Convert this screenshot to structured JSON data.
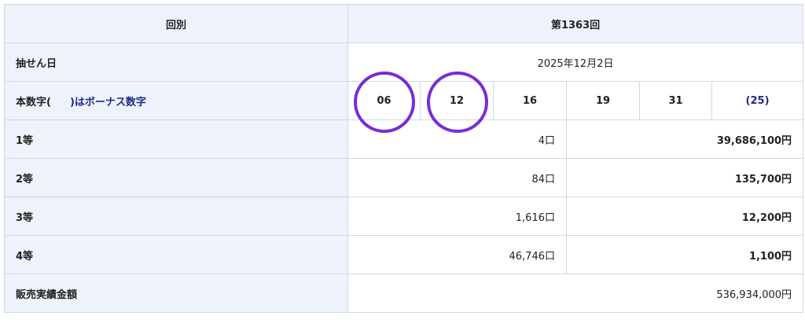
{
  "header": {
    "label": "回別",
    "value": "第1363回"
  },
  "draw_date": {
    "label": "抽せん日",
    "value": "2025年12月2日"
  },
  "numbers": {
    "label_prefix": "本数字(",
    "label_suffix": ")はボーナス数字",
    "main": [
      "06",
      "12",
      "16",
      "19",
      "31"
    ],
    "bonus": "(25)"
  },
  "prizes": [
    {
      "tier": "1等",
      "count": "4口",
      "amount": "39,686,100円"
    },
    {
      "tier": "2等",
      "count": "84口",
      "amount": "135,700円"
    },
    {
      "tier": "3等",
      "count": "1,616口",
      "amount": "12,200円"
    },
    {
      "tier": "4等",
      "count": "46,746口",
      "amount": "1,100円"
    }
  ],
  "sales": {
    "label": "販売実績金額",
    "value": "536,934,000円"
  },
  "colors": {
    "header_bg": "#eef2fb",
    "border": "#cfd8e8",
    "circle": "#7a2bd6",
    "navy": "#1f2a8a"
  }
}
